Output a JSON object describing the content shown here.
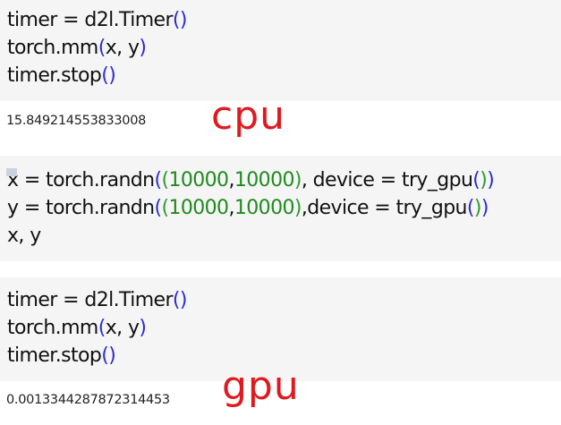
{
  "cell1": {
    "line1": {
      "a": "timer = d2l.Timer",
      "open": "(",
      "close": ")"
    },
    "line2": {
      "a": "torch.mm",
      "open": "(",
      "args": "x, y",
      "close": ")"
    },
    "line3": {
      "a": "timer.stop",
      "open": "(",
      "close": ")"
    }
  },
  "output1": "15.849214553833008",
  "annot_cpu": "cpu",
  "cell2": {
    "line1": {
      "a": "x = torch.randn",
      "o1": "(",
      "o2": "(",
      "n1": "10000",
      "comma": ",",
      "n2": "10000",
      "c1": ")",
      "rest": ", device = try_gpu",
      "o3": "(",
      "c2": ")",
      "c3": ")"
    },
    "line2": {
      "a": "y = torch.randn",
      "o1": "(",
      "o2": "(",
      "n1": "10000",
      "comma": ",",
      "n2": "10000",
      "c1": ")",
      "rest": ",device = try_gpu",
      "o3": "(",
      "c2": ")",
      "c3": ")"
    },
    "line3": {
      "a": "x, y"
    }
  },
  "cell3": {
    "line1": {
      "a": "timer = d2l.Timer",
      "open": "(",
      "close": ")"
    },
    "line2": {
      "a": "torch.mm",
      "open": "(",
      "args": "x, y",
      "close": ")"
    },
    "line3": {
      "a": "timer.stop",
      "open": "(",
      "close": ")"
    }
  },
  "output2": "0.0013344287872314453",
  "annot_gpu": "gpu",
  "colors": {
    "cell_bg": "#f5f5f5",
    "paren": "#2b2bd6",
    "number": "#1f8a1f",
    "annotation": "#e0191f"
  }
}
